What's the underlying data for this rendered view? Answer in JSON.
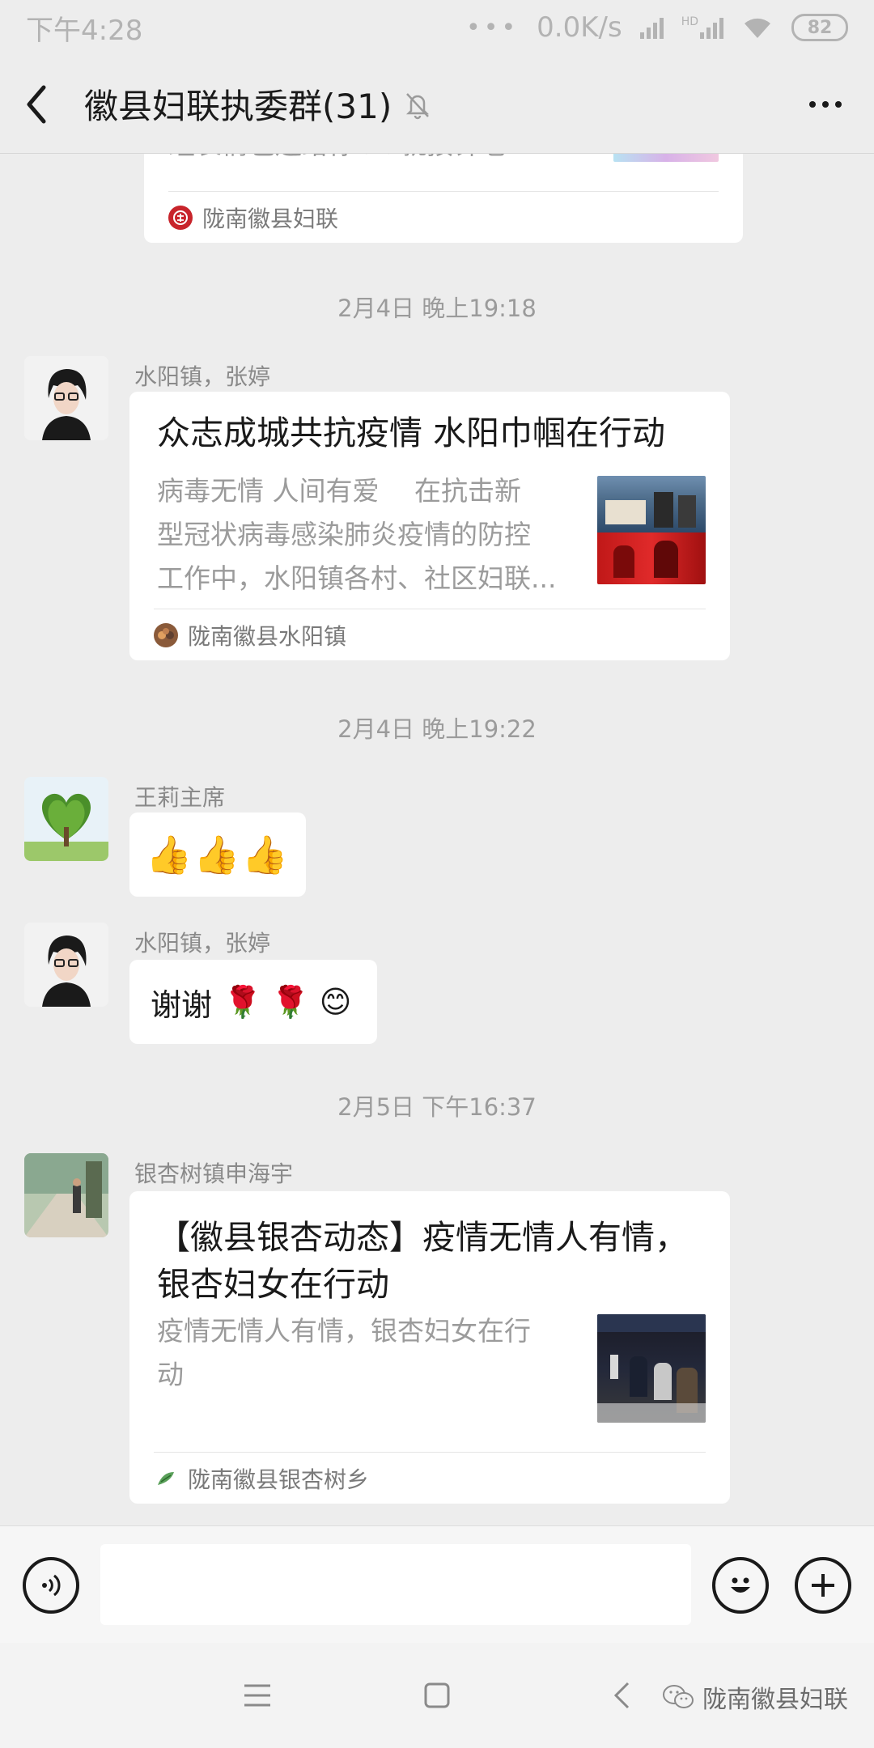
{
  "status_bar": {
    "time": "下午4:28",
    "dots": "•••",
    "net_speed": "0.0K/s",
    "hd": "HD",
    "battery": "82"
  },
  "header": {
    "title": "徽县妇联执委群(31)"
  },
  "top_card": {
    "desc_partial": "组表情包送给你↓↓就按钟老...",
    "source": "陇南徽县妇联"
  },
  "messages": [
    {
      "timestamp": "2月4日 晚上19:18",
      "sender": "水阳镇，张婷",
      "title": "众志成城共抗疫情 水阳巾帼在行动",
      "desc": [
        "病毒无情 人间有爱　 在抗击新",
        "型冠状病毒感染肺炎疫情的防控",
        "工作中，水阳镇各村、社区妇联..."
      ],
      "source": "陇南徽县水阳镇"
    },
    {
      "timestamp": "2月4日 晚上19:22",
      "sender": "王莉主席",
      "emojis": "👍👍👍"
    },
    {
      "sender": "水阳镇，张婷",
      "text": "谢谢",
      "emojis": "🌹 🌹 😊"
    },
    {
      "timestamp": "2月5日 下午16:37",
      "sender": "银杏树镇申海宇",
      "title_lines": [
        "【徽县银杏动态】疫情无情人有情，",
        "银杏妇女在行动"
      ],
      "desc": [
        "疫情无情人有情，银杏妇女在行",
        "动"
      ],
      "source": "陇南徽县银杏树乡"
    }
  ],
  "input_bar": {
    "value": ""
  },
  "watermark": "陇南徽县妇联",
  "icons": {
    "back": "chevron-left-icon",
    "mute": "bell-off-icon",
    "more": "more-dots-icon",
    "voice": "voice-icon",
    "emoji": "emoji-icon",
    "add": "plus-icon",
    "nav_menu": "menu-icon",
    "nav_home": "square-icon",
    "nav_back": "nav-back-icon"
  },
  "colors": {
    "background": "#ededed",
    "bubble": "#ffffff",
    "secondary_text": "#9b9b9b"
  }
}
